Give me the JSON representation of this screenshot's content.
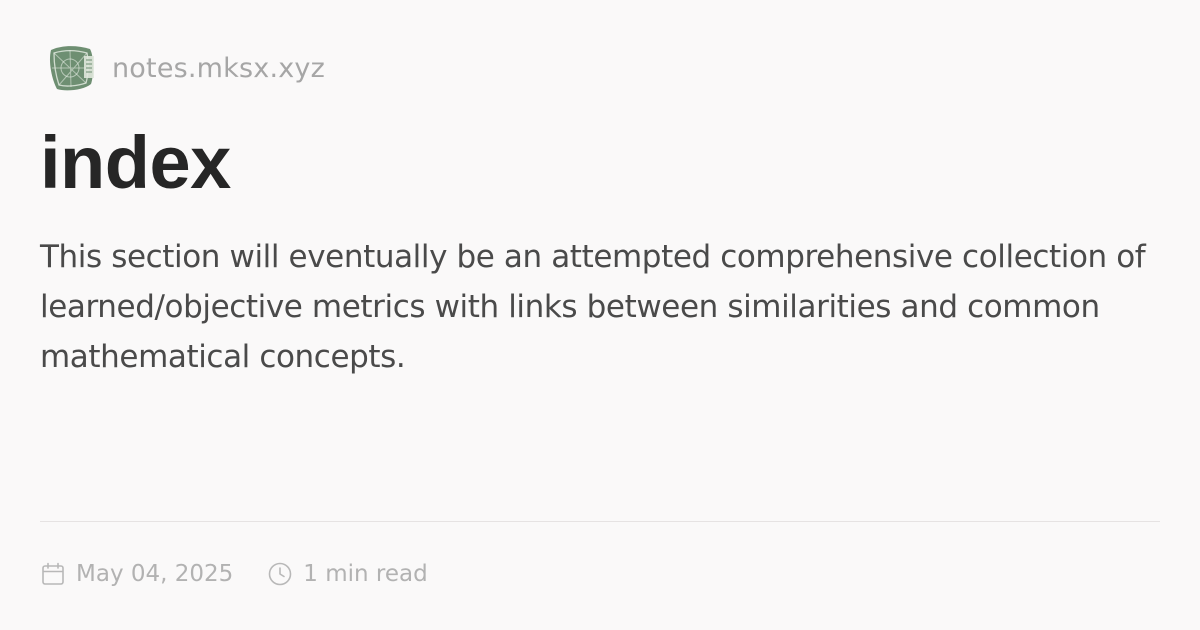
{
  "site": {
    "logo_icon": "site-logo-icon",
    "name": "notes.mksx.xyz"
  },
  "page": {
    "title": "index",
    "description": "This section will eventually be an attempted comprehensive collection of learned/objective metrics with links between similarities and common mathematical concepts."
  },
  "meta": {
    "date_icon": "calendar-icon",
    "date": "May 04, 2025",
    "read_time_icon": "clock-icon",
    "read_time": "1 min read"
  },
  "colors": {
    "background": "#faf9f9",
    "title": "#262626",
    "body_text": "#4a4a4a",
    "muted_text": "#a6a6a6",
    "logo_green": "#6e8f72",
    "divider": "#e6e3e3"
  }
}
